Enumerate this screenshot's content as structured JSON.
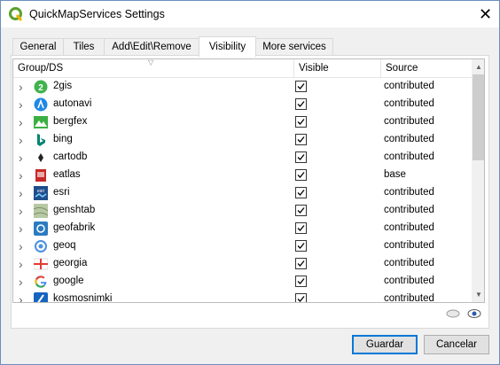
{
  "window": {
    "title": "QuickMapServices Settings",
    "close": "✕"
  },
  "tabs": [
    {
      "label": "General"
    },
    {
      "label": "Tiles"
    },
    {
      "label": "Add\\Edit\\Remove"
    },
    {
      "label": "Visibility",
      "active": true
    },
    {
      "label": "More services"
    }
  ],
  "table": {
    "columns": [
      "Group/DS",
      "Visible",
      "Source"
    ],
    "rows": [
      {
        "name": "2gis",
        "visible": true,
        "source": "contributed",
        "icon": "2gis-icon"
      },
      {
        "name": "autonavi",
        "visible": true,
        "source": "contributed",
        "icon": "autonavi-icon"
      },
      {
        "name": "bergfex",
        "visible": true,
        "source": "contributed",
        "icon": "bergfex-icon"
      },
      {
        "name": "bing",
        "visible": true,
        "source": "contributed",
        "icon": "bing-icon"
      },
      {
        "name": "cartodb",
        "visible": true,
        "source": "contributed",
        "icon": "cartodb-icon"
      },
      {
        "name": "eatlas",
        "visible": true,
        "source": "base",
        "icon": "eatlas-icon"
      },
      {
        "name": "esri",
        "visible": true,
        "source": "contributed",
        "icon": "esri-icon"
      },
      {
        "name": "genshtab",
        "visible": true,
        "source": "contributed",
        "icon": "genshtab-icon"
      },
      {
        "name": "geofabrik",
        "visible": true,
        "source": "contributed",
        "icon": "geofabrik-icon"
      },
      {
        "name": "geoq",
        "visible": true,
        "source": "contributed",
        "icon": "geoq-icon"
      },
      {
        "name": "georgia",
        "visible": true,
        "source": "contributed",
        "icon": "georgia-icon"
      },
      {
        "name": "google",
        "visible": true,
        "source": "contributed",
        "icon": "google-icon"
      },
      {
        "name": "kosmosnimki",
        "visible": true,
        "source": "contributed",
        "icon": "kosmosnimki-icon"
      }
    ]
  },
  "buttons": {
    "ok": "Guardar",
    "cancel": "Cancelar"
  },
  "colors": {
    "accent": "#0078d7",
    "qgis_green": "#5aa02c"
  }
}
